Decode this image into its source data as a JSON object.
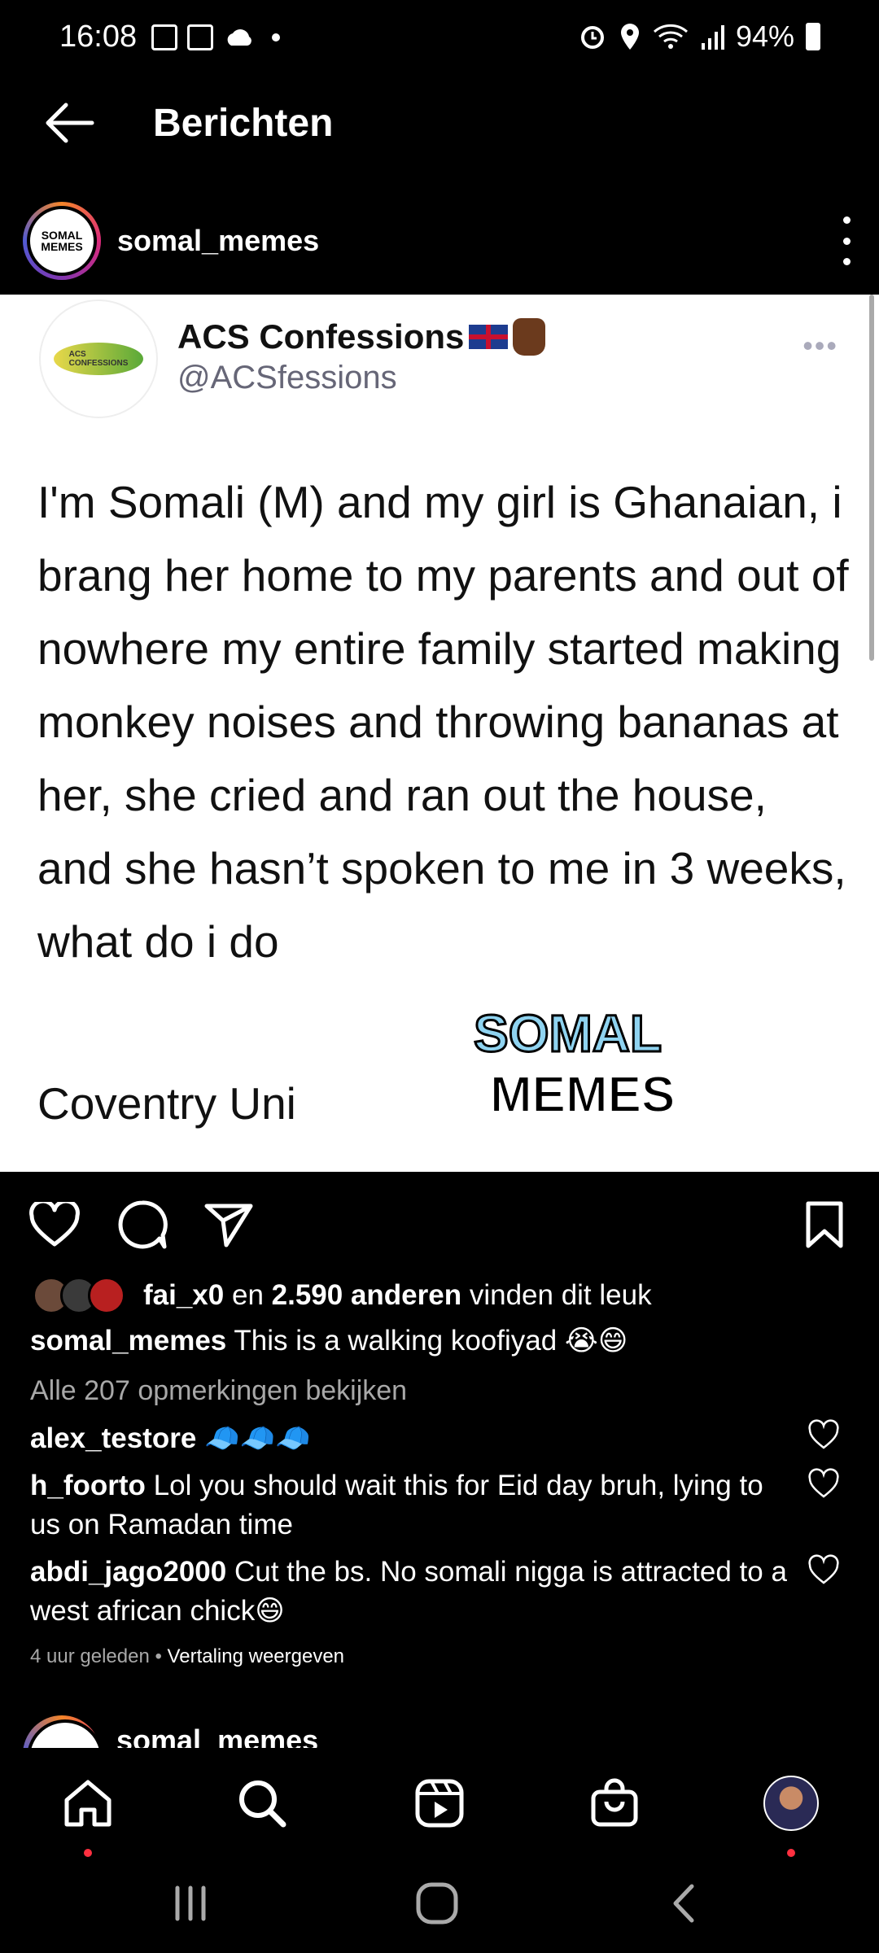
{
  "status_bar": {
    "time": "16:08",
    "battery": "94%"
  },
  "header": {
    "title": "Berichten"
  },
  "post": {
    "username": "somal_memes",
    "avatar_text": "SOMAL MEMES",
    "tweet": {
      "name": "ACS Confessions",
      "handle": "@ACSfessions",
      "avatar_text": "ACS CONFESSIONS",
      "text": "I'm Somali (M) and my girl is Ghanaian, i brang her home to my parents and out of nowhere my entire family started making monkey noises and throwing bananas at her, she cried and ran out the house, and she hasn’t spoken to me in 3 weeks, what do i do",
      "footer": "Coventry Uni",
      "watermark_top": "SOMAL",
      "watermark_bottom": "MEMES"
    },
    "likes": {
      "user": "fai_x0",
      "mid": " en ",
      "count": "2.590 anderen",
      "suffix": " vinden dit leuk"
    },
    "caption": {
      "user": "somal_memes",
      "text": " This is a walking koofiyad 😭😄"
    },
    "view_all": "Alle 207 opmerkingen bekijken",
    "comments": [
      {
        "user": "alex_testore",
        "text": " 🧢🧢🧢"
      },
      {
        "user": "h_foorto",
        "text": " Lol you should wait this for Eid day bruh, lying to us on Ramadan time"
      },
      {
        "user": "abdi_jago2000",
        "text": " Cut the bs. No somali nigga is attracted to a west african chick😄"
      }
    ],
    "timestamp": "4 uur geleden",
    "separator": " • ",
    "translate": "Vertaling weergeven"
  },
  "next_post": {
    "username": "somal_memes"
  },
  "colors": {
    "accent_red": "#ff3040",
    "muted": "#a8a8a8"
  }
}
